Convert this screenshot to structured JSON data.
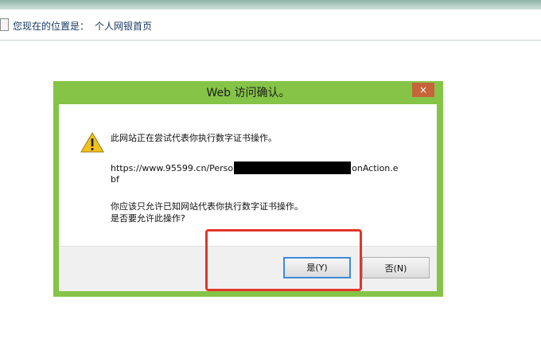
{
  "location": {
    "label": "您现在的位置是：",
    "value": "个人网银首页"
  },
  "dialog": {
    "title": "Web 访问确认。",
    "close_label": "×",
    "message1": "此网站正在尝试代表你执行数字证书操作。",
    "url_prefix": "https://www.95599.cn/Perso",
    "url_suffix": "onAction.e",
    "url_wrap": "bf",
    "message2": "你应该只允许已知网站代表你执行数字证书操作。",
    "message3": "是否要允许此操作?",
    "yes_label": "是(Y)",
    "no_label": "否(N)"
  },
  "colors": {
    "dialog_frame": "#85c446",
    "close_button": "#c6643a",
    "highlight": "#e2362b"
  }
}
